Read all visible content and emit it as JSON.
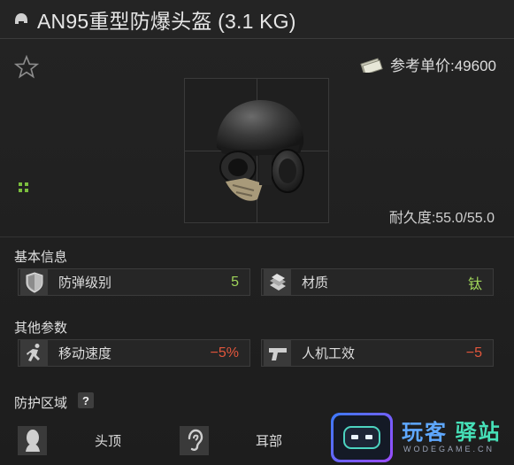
{
  "header": {
    "title": "AN95重型防爆头盔 (3.1 KG)",
    "icon": "helmet-icon"
  },
  "item": {
    "price": "参考单价:49600",
    "durability": "耐久度:55.0/55.0",
    "grade_color": "#7bbd3e"
  },
  "sections": {
    "basic": "基本信息",
    "other": "其他参数",
    "protection": "防护区域"
  },
  "basic_stats": [
    {
      "label": "防弹级别",
      "value": "5",
      "icon": "shield-icon"
    },
    {
      "label": "材质",
      "value": "钛",
      "icon": "material-icon"
    }
  ],
  "other_stats": [
    {
      "label": "移动速度",
      "value": "−5%",
      "icon": "running-man-icon"
    },
    {
      "label": "人机工效",
      "value": "−5",
      "icon": "pistol-icon"
    }
  ],
  "protection_help": "?",
  "zones": [
    {
      "label": "头顶",
      "icon": "head-icon"
    },
    {
      "label": "耳部",
      "icon": "ear-icon"
    }
  ],
  "watermark": {
    "brand_a": "玩客",
    "brand_b": "驿站",
    "url": "WODEGAME.CN"
  },
  "colors": {
    "positive": "#9fd45a",
    "negative": "#e2563c",
    "background": "#1b1b1b"
  }
}
